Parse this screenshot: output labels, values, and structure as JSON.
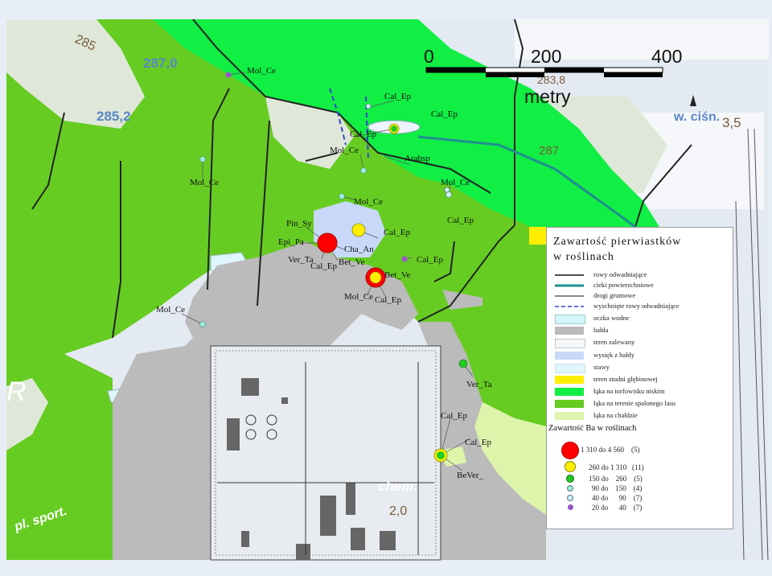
{
  "scale": {
    "ticks": [
      "0",
      "200",
      "400"
    ],
    "unit": "metry"
  },
  "topo_labels": {
    "h285": "285",
    "h2870": "287,0",
    "h2852": "285,2",
    "h283": "283,8",
    "h287": "287",
    "h35": "3,5",
    "wcish": "w. ciśn.",
    "chem": "chem.",
    "h20": "2,0",
    "plsport": "pl. sport.",
    "r": "R"
  },
  "sample_labels": [
    {
      "id": "s1",
      "text": "Mol_Ce"
    },
    {
      "id": "s2",
      "text": "Cal_Ep"
    },
    {
      "id": "s3",
      "text": "Cal_Ep"
    },
    {
      "id": "s4",
      "text": "Cal_Ep"
    },
    {
      "id": "s5",
      "text": "Mol_Ce"
    },
    {
      "id": "s6",
      "text": "Arabsp"
    },
    {
      "id": "s7",
      "text": "Mol_Ce"
    },
    {
      "id": "s8",
      "text": "Mol_Ce"
    },
    {
      "id": "s9",
      "text": "Mol_Ce"
    },
    {
      "id": "s10",
      "text": "Pin_Sy"
    },
    {
      "id": "s11",
      "text": "Cal_Ep"
    },
    {
      "id": "s12",
      "text": "Cal_Ep"
    },
    {
      "id": "s13",
      "text": "Epi_Pa"
    },
    {
      "id": "s14",
      "text": "Cha_An"
    },
    {
      "id": "s15",
      "text": "Ver_Ta"
    },
    {
      "id": "s16",
      "text": "Cal_Ep"
    },
    {
      "id": "s17",
      "text": "Bet_Ve"
    },
    {
      "id": "s18",
      "text": "Cal_Ep"
    },
    {
      "id": "s19",
      "text": "Bet_Ve"
    },
    {
      "id": "s20",
      "text": "Mol_Ce"
    },
    {
      "id": "s21",
      "text": "Cal_Ep"
    },
    {
      "id": "s22",
      "text": "Mol_Ce"
    },
    {
      "id": "s23",
      "text": "Ver_Ta"
    },
    {
      "id": "s24",
      "text": "Cal_Ep"
    },
    {
      "id": "s25",
      "text": "Cal_Ep"
    },
    {
      "id": "s26",
      "text": "BeVer_"
    }
  ],
  "legend": {
    "title_line1": "Zawartość pierwiastków",
    "title_line2": "w roślinach",
    "items": [
      {
        "label": "rowy odwadniające",
        "symbol": "line-black"
      },
      {
        "label": "cieki powierzchniowe",
        "symbol": "line-teal"
      },
      {
        "label": "drogi gruntowe",
        "symbol": "line-black-thin"
      },
      {
        "label": "wyschnięte rowy odwadniające",
        "symbol": "line-dashed-blue"
      },
      {
        "label": "oczka wodne",
        "symbol": "fill-lightcyan"
      },
      {
        "label": "hałda",
        "symbol": "fill-gray"
      },
      {
        "label": "teren zalewany",
        "symbol": "fill-dotted"
      },
      {
        "label": "wysięk z hałdy",
        "symbol": "fill-lightblue"
      },
      {
        "label": "stawy",
        "symbol": "fill-paleblue"
      },
      {
        "label": "teren studni głębinowej",
        "symbol": "fill-yellow"
      },
      {
        "label": "łąka na torfowisku niskim",
        "symbol": "fill-brightgreen"
      },
      {
        "label": "łąka na terenie spalonego lasu",
        "symbol": "fill-green"
      },
      {
        "label": "łąka na chałdzie",
        "symbol": "fill-palegreen"
      }
    ],
    "ba_title": "Zawartość Ba w roślinach",
    "ba_classes": [
      {
        "text": "1 310 do 4 560    (5)",
        "color": "#ff0000"
      },
      {
        "text": "260 do 1 310   (11)",
        "color": "#ffff00"
      },
      {
        "text": "150 do    260    (5)",
        "color": "#22cc22"
      },
      {
        "text": "90 do    150    (4)",
        "color": "#99eedd"
      },
      {
        "text": "40 do      90    (7)",
        "color": "#cceeff"
      },
      {
        "text": "20 do      40    (7)",
        "color": "#9955cc"
      }
    ]
  },
  "colors": {
    "meadow_burnt_forest": "#66cc22",
    "meadow_peat": "#11ee44",
    "dump": "#bbbbbb",
    "seep": "#c8d8f8",
    "well": "#ffee00",
    "meadow_dump": "#ddf4aa",
    "background": "#e8eef8"
  }
}
